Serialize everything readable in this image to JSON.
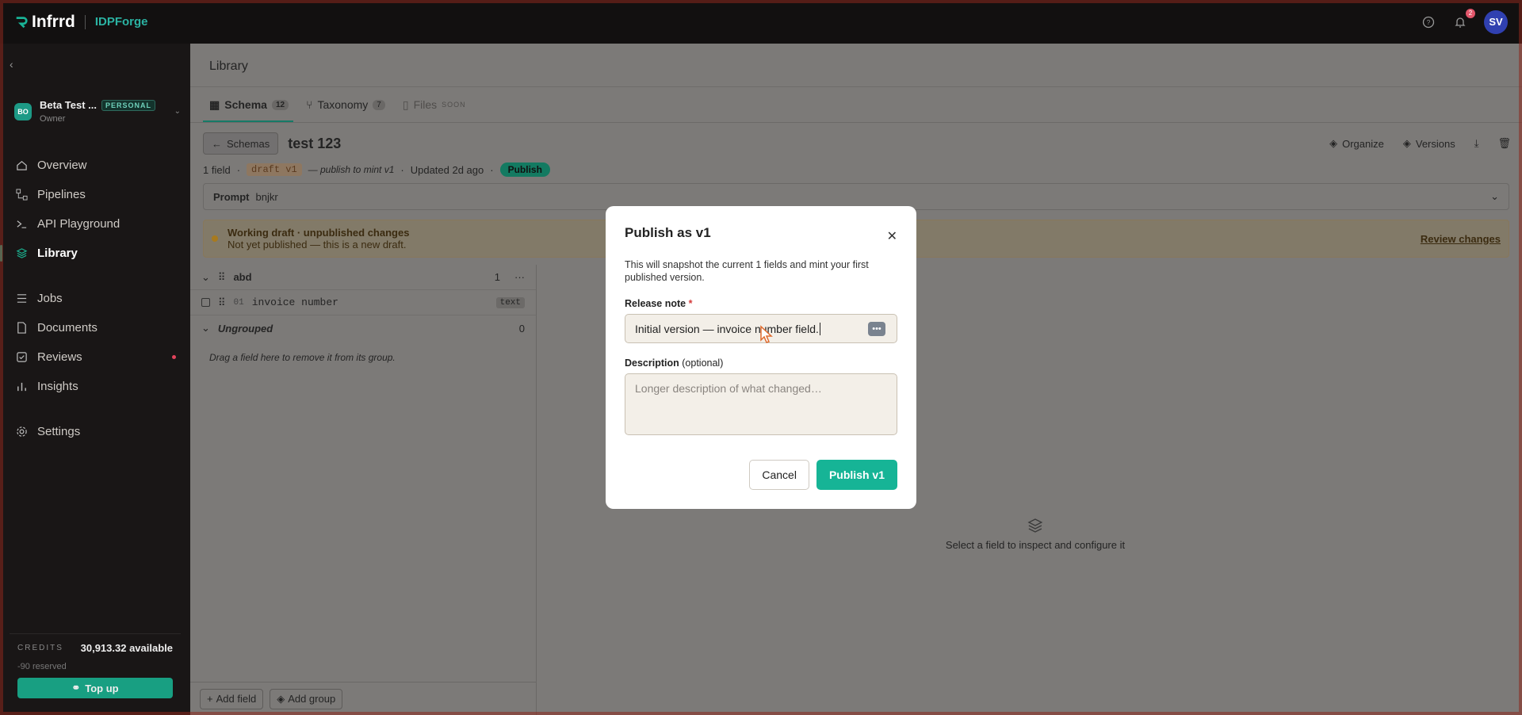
{
  "topbar": {
    "brand": "Infrrd",
    "product": "IDPForge",
    "notifications": "2",
    "user_initials": "SV"
  },
  "sidebar": {
    "workspace": {
      "initials": "BO",
      "name": "Beta Test ...",
      "tag": "PERSONAL",
      "role": "Owner"
    },
    "nav": [
      {
        "label": "Overview",
        "icon": "home-icon"
      },
      {
        "label": "Pipelines",
        "icon": "pipeline-icon"
      },
      {
        "label": "API Playground",
        "icon": "terminal-icon"
      },
      {
        "label": "Library",
        "icon": "layers-icon",
        "active": true
      },
      {
        "label": "Jobs",
        "icon": "list-icon"
      },
      {
        "label": "Documents",
        "icon": "document-icon"
      },
      {
        "label": "Reviews",
        "icon": "check-square-icon",
        "dot": true
      },
      {
        "label": "Insights",
        "icon": "chart-icon"
      },
      {
        "label": "Settings",
        "icon": "gear-icon"
      }
    ],
    "credits": {
      "label": "CREDITS",
      "available": "30,913.32 available",
      "reserved": "-90 reserved",
      "topup": "Top up"
    }
  },
  "main": {
    "title": "Library",
    "tabs": [
      {
        "label": "Schema",
        "count": "12"
      },
      {
        "label": "Taxonomy",
        "count": "7"
      },
      {
        "label": "Files",
        "tag": "SOON"
      }
    ],
    "back_label": "Schemas",
    "schema_name": "test 123",
    "actions": {
      "organize": "Organize",
      "versions": "Versions"
    },
    "meta": {
      "fields": "1 field",
      "draft": "draft v1",
      "draft_hint": "— publish to mint v1",
      "updated": "Updated 2d ago",
      "publish": "Publish"
    },
    "prompt": {
      "label": "Prompt",
      "value": "bnjkr"
    },
    "warning": {
      "title": "Working draft · unpublished changes",
      "body": "Not yet published — this is a new draft.",
      "link": "Review changes"
    },
    "tree": {
      "group": {
        "name": "abd",
        "count": "1"
      },
      "field": {
        "index": "01",
        "name": "invoice number",
        "type": "text"
      },
      "ungrouped": {
        "name": "Ungrouped",
        "count": "0"
      },
      "hint": "Drag a field here to remove it from its group.",
      "add_field": "Add field",
      "add_group": "Add group"
    },
    "inspector_empty": "Select a field to inspect and configure it"
  },
  "modal": {
    "title": "Publish as v1",
    "lead": "This will snapshot the current 1 fields and mint your first published version.",
    "release_label": "Release note",
    "release_required": "*",
    "release_value": "Initial version — invoice number field.",
    "desc_label": "Description",
    "desc_optional": "(optional)",
    "desc_placeholder": "Longer description of what changed…",
    "cancel": "Cancel",
    "publish": "Publish v1"
  },
  "colors": {
    "accent": "#16b496",
    "brand": "#2bb3a3",
    "warning": "#a87a1e"
  }
}
